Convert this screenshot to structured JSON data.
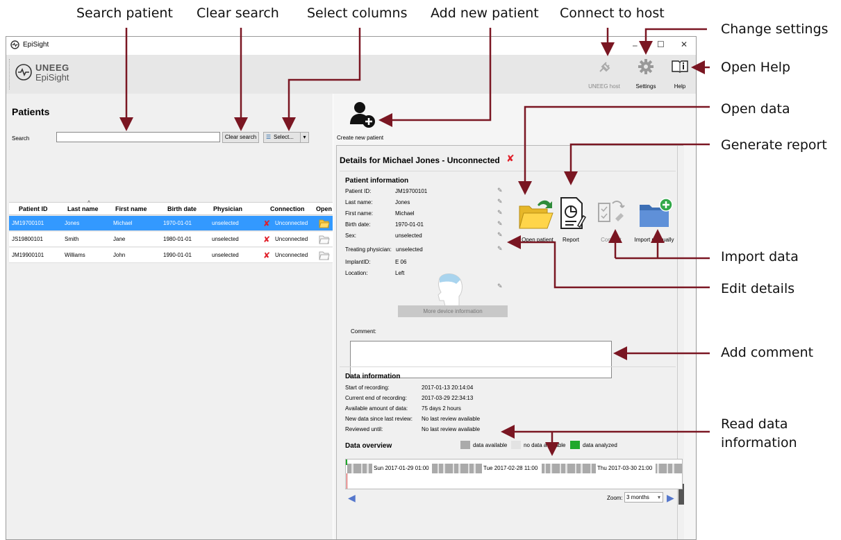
{
  "callouts": {
    "search_patient": "Search patient",
    "clear_search": "Clear search",
    "select_columns": "Select columns",
    "add_new_patient": "Add new patient",
    "connect_to_host": "Connect to host",
    "change_settings": "Change settings",
    "open_help": "Open Help",
    "open_data": "Open data",
    "generate_report": "Generate report",
    "import_data": "Import data",
    "edit_details": "Edit details",
    "add_comment": "Add comment",
    "read_data_information": "Read data information"
  },
  "window": {
    "title": "EpiSight",
    "logo_line1": "UNEEG",
    "logo_line2": "EpiSight",
    "minimize": "–",
    "maximize": "☐",
    "close": "✕"
  },
  "toolbar": {
    "uneeg_host": "UNEEG host",
    "settings": "Settings",
    "help": "Help"
  },
  "patients": {
    "title": "Patients",
    "search_label": "Search",
    "search_value": "",
    "clear_search": "Clear search",
    "select": "Select...",
    "columns": [
      "Patient ID",
      "Last name",
      "First name",
      "Birth date",
      "Physician",
      "Connection",
      "Open"
    ],
    "rows": [
      {
        "id": "JM19700101",
        "last": "Jones",
        "first": "Michael",
        "birth": "1970-01-01",
        "physician": "unselected",
        "connection": "Unconnected"
      },
      {
        "id": "JS19800101",
        "last": "Smith",
        "first": "Jane",
        "birth": "1980-01-01",
        "physician": "unselected",
        "connection": "Unconnected"
      },
      {
        "id": "JM19900101",
        "last": "Williams",
        "first": "John",
        "birth": "1990-01-01",
        "physician": "unselected",
        "connection": "Unconnected"
      }
    ]
  },
  "create_patient_label": "Create new patient",
  "details": {
    "title": "Details for Michael Jones - Unconnected",
    "patient_info_title": "Patient information",
    "fields": [
      {
        "label": "Patient ID:",
        "value": "JM19700101"
      },
      {
        "label": "Last name:",
        "value": "Jones"
      },
      {
        "label": "First name:",
        "value": "Michael"
      },
      {
        "label": "Birth date:",
        "value": "1970-01-01"
      },
      {
        "label": "Sex:",
        "value": "unselected"
      }
    ],
    "treating_label": "Treating physician:",
    "treating_value": "unselected",
    "implant_label": "ImplantID:",
    "implant_value": "E 06",
    "location_label": "Location:",
    "location_value": "Left",
    "more_device": "More device information",
    "comment_label": "Comment:",
    "comment_value": "",
    "actions": {
      "open_patient": "Open patient",
      "report": "Report",
      "connect": "Connect",
      "import_manually": "Import manually"
    }
  },
  "data_info": {
    "title": "Data information",
    "rows": [
      {
        "label": "Start of recording:",
        "value": "2017-01-13 20:14:04"
      },
      {
        "label": "Current end of recording:",
        "value": "2017-03-29 22:34:13"
      },
      {
        "label": "Available amount of data:",
        "value": "75 days 2 hours"
      },
      {
        "label": "New data since last review:",
        "value": "No last review available"
      },
      {
        "label": "Reviewed until:",
        "value": "No last review available"
      }
    ],
    "overview_title": "Data overview",
    "legend": {
      "available": "data available",
      "no_data": "no data available",
      "analyzed": "data analyzed"
    },
    "colors": {
      "available": "#aaaaaa",
      "no_data": "#e3e3e3",
      "analyzed": "#1fa82b"
    },
    "ticks": [
      "Sun 2017-01-29 01:00",
      "Tue 2017-02-28 11:00",
      "Thu 2017-03-30 21:00"
    ],
    "zoom_label": "Zoom:",
    "zoom_value": "3 months"
  },
  "colors": {
    "arrow": "#7a1622",
    "selection": "#3399ff"
  }
}
